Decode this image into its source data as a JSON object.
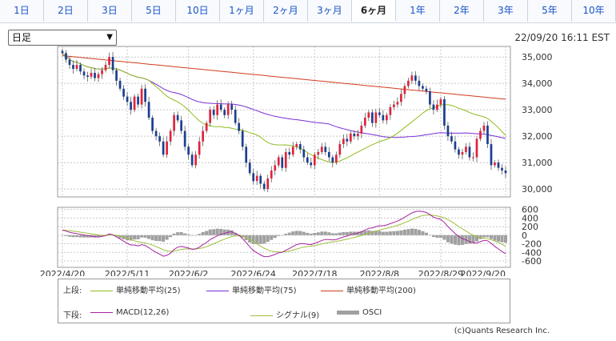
{
  "tabs": [
    {
      "label": "1日",
      "active": false
    },
    {
      "label": "2日",
      "active": false
    },
    {
      "label": "3日",
      "active": false
    },
    {
      "label": "5日",
      "active": false
    },
    {
      "label": "10日",
      "active": false
    },
    {
      "label": "1ヶ月",
      "active": false
    },
    {
      "label": "2ヶ月",
      "active": false
    },
    {
      "label": "3ヶ月",
      "active": false
    },
    {
      "label": "6ヶ月",
      "active": true
    },
    {
      "label": "1年",
      "active": false
    },
    {
      "label": "2年",
      "active": false
    },
    {
      "label": "3年",
      "active": false
    },
    {
      "label": "5年",
      "active": false
    },
    {
      "label": "10年",
      "active": false
    }
  ],
  "period_select": {
    "value": "日足"
  },
  "timestamp": "22/09/20 16:11 EST",
  "copyright": "(c)Quants Research Inc.",
  "legend": {
    "upper_label": "上段:",
    "lower_label": "下段:",
    "upper": [
      {
        "name": "単純移動平均(25)",
        "color": "#8fbc1f"
      },
      {
        "name": "単純移動平均(75)",
        "color": "#7a2fd6"
      },
      {
        "name": "単純移動平均(200)",
        "color": "#d23b1e"
      }
    ],
    "lower": [
      {
        "name": "MACD(12,26)",
        "color": "#a6249e",
        "type": "line"
      },
      {
        "name": "シグナル(9)",
        "color": "#9fbf3a",
        "type": "line"
      },
      {
        "name": "OSCI",
        "color": "#a0a0a0",
        "type": "bar"
      }
    ]
  },
  "colors": {
    "up": "#e0233c",
    "down": "#1b3f8f",
    "grid": "#c8c8c8"
  },
  "chart_data": [
    {
      "type": "candlestick",
      "title": "",
      "x_ticks": [
        "2022/4/20",
        "2022/5/11",
        "2022/6/2",
        "2022/6/24",
        "2022/7/18",
        "2022/8/8",
        "2022/8/29",
        "2022/9/20"
      ],
      "y_ticks": [
        "30,000",
        "31,000",
        "32,000",
        "33,000",
        "34,000",
        "35,000"
      ],
      "ylim": [
        29700,
        35400
      ],
      "grid": true,
      "close": [
        35150,
        34900,
        34700,
        34550,
        34700,
        34450,
        34300,
        34250,
        34400,
        34200,
        34350,
        34500,
        34700,
        35000,
        34500,
        34100,
        33800,
        33500,
        33300,
        33000,
        33500,
        33200,
        33800,
        33300,
        32700,
        32200,
        32000,
        31800,
        31300,
        31800,
        32200,
        32800,
        32600,
        32200,
        31600,
        31300,
        30900,
        31300,
        31800,
        32200,
        32500,
        33000,
        32800,
        33200,
        33000,
        32800,
        33200,
        33000,
        32500,
        32200,
        31600,
        31000,
        30600,
        30300,
        30500,
        30200,
        30000,
        30400,
        30700,
        30900,
        31200,
        30800,
        31400,
        31300,
        31600,
        31700,
        31500,
        31200,
        31000,
        30900,
        31300,
        31400,
        31600,
        31400,
        31200,
        31000,
        31300,
        31700,
        31900,
        31800,
        32100,
        32000,
        32100,
        32400,
        32700,
        32900,
        32500,
        32900,
        32800,
        32600,
        32800,
        33100,
        33200,
        33300,
        33600,
        33900,
        34100,
        34300,
        34100,
        33900,
        33800,
        33700,
        33200,
        33000,
        33200,
        33400,
        32400,
        32000,
        31800,
        31500,
        31300,
        31400,
        31600,
        31200,
        31200,
        31900,
        32200,
        32400,
        31700,
        30900,
        31000,
        30800,
        30700,
        30600
      ]
    },
    {
      "type": "macd",
      "y_ticks": [
        "600",
        "400",
        "200",
        "0",
        "-200",
        "-400",
        "-600"
      ],
      "ylim": [
        -750,
        650
      ],
      "macd": [
        120,
        95,
        70,
        50,
        40,
        20,
        5,
        -10,
        -20,
        -35,
        -40,
        -30,
        -10,
        30,
        10,
        -40,
        -90,
        -140,
        -190,
        -230,
        -230,
        -250,
        -220,
        -240,
        -290,
        -350,
        -400,
        -440,
        -490,
        -470,
        -420,
        -330,
        -280,
        -260,
        -280,
        -300,
        -330,
        -320,
        -280,
        -220,
        -170,
        -100,
        -60,
        -10,
        20,
        40,
        70,
        80,
        40,
        0,
        -80,
        -170,
        -270,
        -360,
        -410,
        -460,
        -500,
        -500,
        -480,
        -450,
        -410,
        -400,
        -350,
        -310,
        -260,
        -220,
        -200,
        -200,
        -210,
        -220,
        -190,
        -160,
        -120,
        -100,
        -100,
        -110,
        -100,
        -70,
        -40,
        -20,
        10,
        30,
        50,
        80,
        120,
        160,
        170,
        200,
        220,
        220,
        240,
        270,
        300,
        330,
        370,
        420,
        470,
        520,
        550,
        560,
        550,
        530,
        480,
        420,
        390,
        370,
        300,
        200,
        120,
        40,
        -30,
        -80,
        -110,
        -150,
        -180,
        -180,
        -150,
        -120,
        -130,
        -190,
        -260,
        -320,
        -380,
        -430
      ]
    }
  ]
}
